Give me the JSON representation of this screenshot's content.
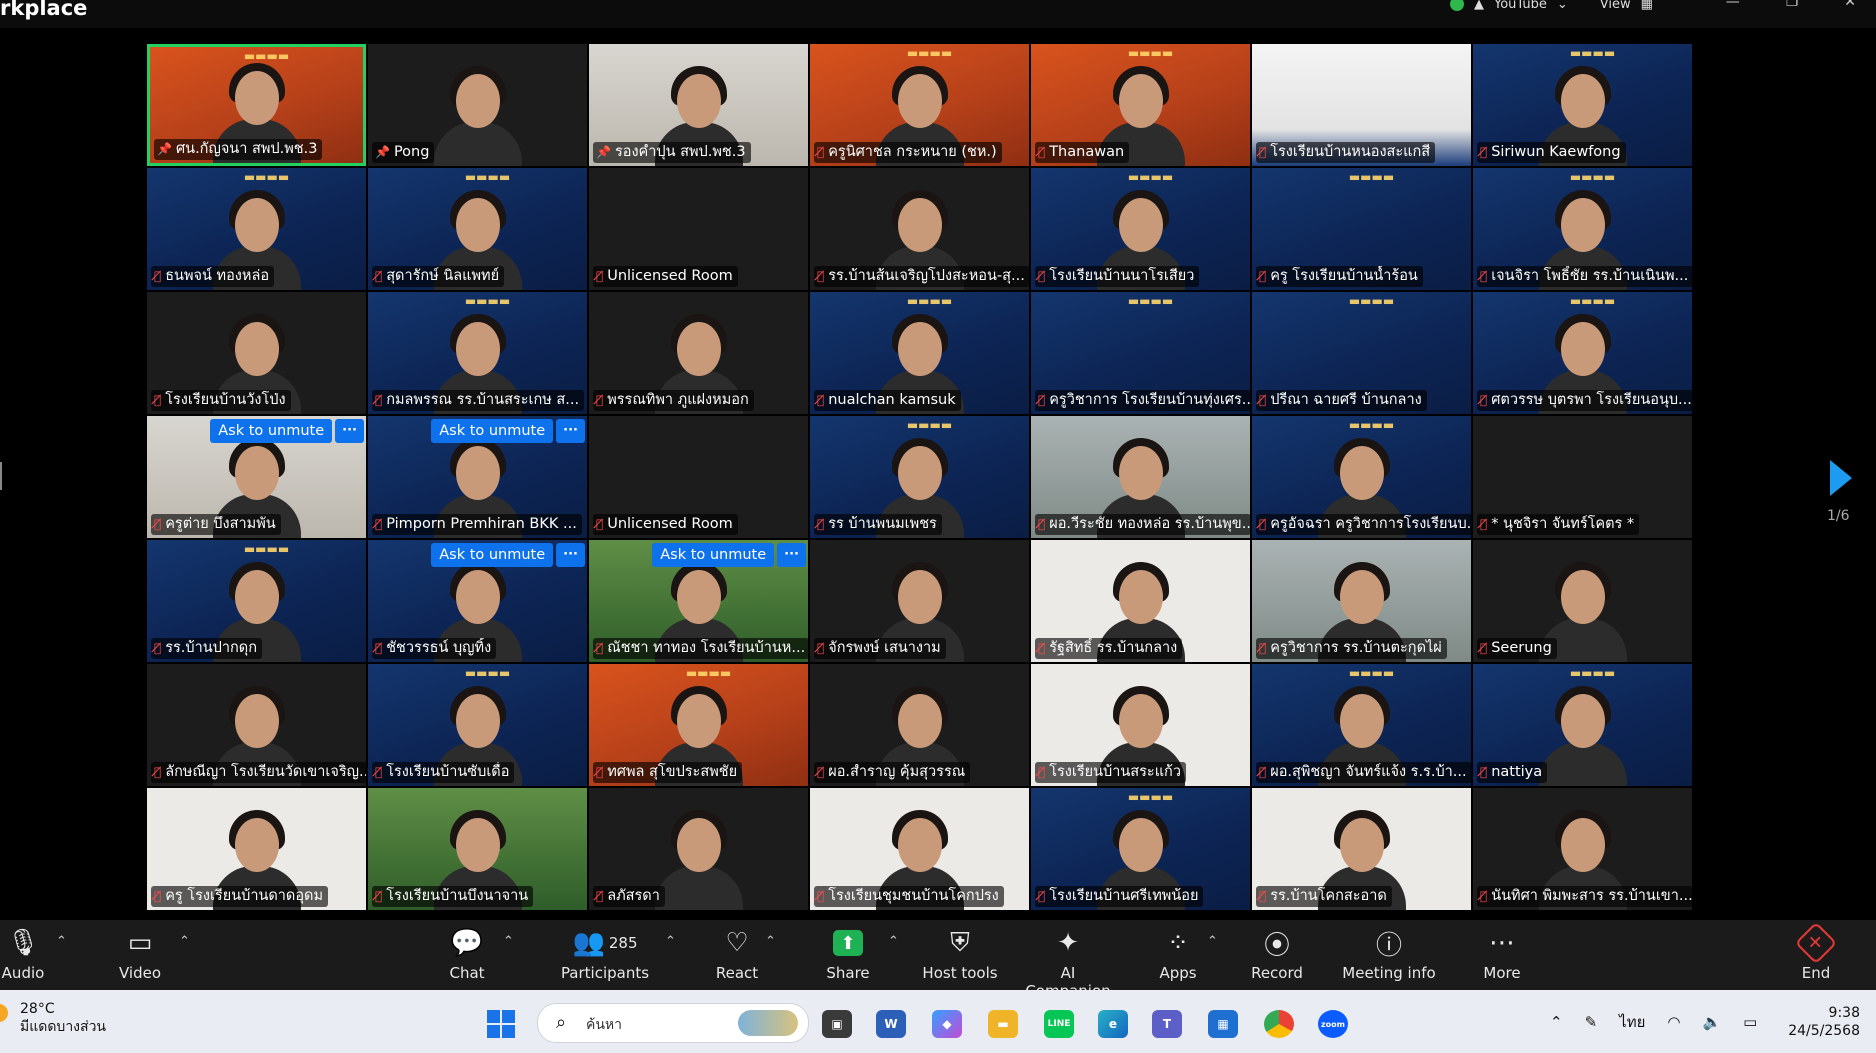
{
  "window": {
    "title": "rkplace",
    "youtube_label": "YouTube",
    "view_label": "View"
  },
  "gallery": {
    "page_indicator": "1/6",
    "unmute_label": "Ask to unmute",
    "more_label": "···",
    "tiles": [
      {
        "name": "ศน.กัญจนา สพป.พช.3",
        "icon": "pin",
        "bg": "orange",
        "active": true,
        "person": true
      },
      {
        "name": "Pong",
        "icon": "pin",
        "bg": "dark",
        "person": true
      },
      {
        "name": "รองคำปุน สพป.พช.3",
        "icon": "pin",
        "bg": "wall",
        "person": true
      },
      {
        "name": "ครูนิศาชล กระหนาย (ชห.)",
        "icon": "mic-off",
        "bg": "orange",
        "person": true
      },
      {
        "name": "Thanawan",
        "icon": "mic-off",
        "bg": "orange",
        "person": true
      },
      {
        "name": "โรงเรียนบ้านหนองสะแกสี",
        "icon": "mic-off",
        "bg": "slide",
        "person": false
      },
      {
        "name": "Siriwun Kaewfong",
        "icon": "mic-off",
        "bg": "blue",
        "person": true
      },
      {
        "name": "ธนพจน์ ทองหล่อ",
        "icon": "mic-off",
        "bg": "blue",
        "person": true
      },
      {
        "name": "สุดารักษ์ นิลแพทย์",
        "icon": "mic-off",
        "bg": "blue",
        "person": true
      },
      {
        "name": "Unlicensed Room",
        "icon": "mic-off",
        "bg": "dark",
        "person": false
      },
      {
        "name": "รร.บ้านส้นเจริญโปงสะหอน-สุ...",
        "icon": "mic-off",
        "bg": "dark",
        "person": true
      },
      {
        "name": "โรงเรียนบ้านนาโรเสียว",
        "icon": "mic-off",
        "bg": "blue",
        "person": true
      },
      {
        "name": "ครู โรงเรียนบ้านน้ำร้อน",
        "icon": "mic-off",
        "bg": "blue",
        "person": false
      },
      {
        "name": "เจนจิรา โพธิ์ชัย รร.บ้านเนินพ...",
        "icon": "mic-off",
        "bg": "blue",
        "person": true
      },
      {
        "name": "โรงเรียนบ้านวังโป่ง",
        "icon": "mic-off",
        "bg": "dark",
        "person": true
      },
      {
        "name": "กมลพรรณ รร.บ้านสระเกษ ส...",
        "icon": "mic-off",
        "bg": "blue",
        "person": true
      },
      {
        "name": "พรรณทิพา ภูแฝงหมอก",
        "icon": "mic-off",
        "bg": "dark",
        "person": true
      },
      {
        "name": "nualchan kamsuk",
        "icon": "mic-off",
        "bg": "blue",
        "person": true
      },
      {
        "name": "ครูวิชาการ โรงเรียนบ้านทุ่งเศร...",
        "icon": "mic-off",
        "bg": "blue",
        "person": false
      },
      {
        "name": "ปรีณา ฉายศรี บ้านกลาง",
        "icon": "mic-off",
        "bg": "blue",
        "person": false
      },
      {
        "name": "ศตวรรษ บุตรพา โรงเรียนอนุบ...",
        "icon": "mic-off",
        "bg": "blue",
        "person": true
      },
      {
        "name": "ครูต่าย บึงสามพัน",
        "icon": "mic-off",
        "bg": "wall",
        "person": true,
        "unmute": true
      },
      {
        "name": "Pimporn Premhiran BKK ...",
        "icon": "mic-off",
        "bg": "blue",
        "person": true,
        "unmute": true
      },
      {
        "name": "Unlicensed Room",
        "icon": "mic-off",
        "bg": "dark",
        "person": false
      },
      {
        "name": "รร บ้านพนมเพชร",
        "icon": "mic-off",
        "bg": "blue",
        "person": true
      },
      {
        "name": "ผอ.วีระชัย ทองหล่อ รร.บ้านพุข...",
        "icon": "mic-off",
        "bg": "room",
        "person": true
      },
      {
        "name": "ครูอัจฉรา ครูวิชาการโรงเรียนบ...",
        "icon": "mic-off",
        "bg": "blue",
        "person": true
      },
      {
        "name": "* นุชจิรา จันทร์โคตร *",
        "icon": "mic-off",
        "bg": "dark",
        "person": false
      },
      {
        "name": "รร.บ้านปากดุก",
        "icon": "mic-off",
        "bg": "blue",
        "person": true
      },
      {
        "name": "ชัชวรรธน์ บุญทิ้ง",
        "icon": "mic-off",
        "bg": "blue",
        "person": true,
        "unmute": true
      },
      {
        "name": "ณัชชา ทาทอง โรงเรียนบ้านห...",
        "icon": "mic-off",
        "bg": "green",
        "person": true,
        "unmute": true
      },
      {
        "name": "จักรพงษ์ เสนางาม",
        "icon": "mic-off",
        "bg": "dark",
        "person": true
      },
      {
        "name": "รัฐสิทธิ์ รร.บ้านกลาง",
        "icon": "mic-off",
        "bg": "white",
        "person": true
      },
      {
        "name": "ครูวิชาการ รร.บ้านตะกุดไผ่",
        "icon": "mic-off",
        "bg": "room",
        "person": true
      },
      {
        "name": "Seerung",
        "icon": "mic-off",
        "bg": "dark",
        "person": true
      },
      {
        "name": "ลักษณีญา โรงเรียนวัดเขาเจริญ...",
        "icon": "mic-off",
        "bg": "dark",
        "person": true
      },
      {
        "name": "โรงเรียนบ้านซับเดื่อ",
        "icon": "mic-off",
        "bg": "blue",
        "person": true
      },
      {
        "name": "ทศพล สุโขประสพชัย",
        "icon": "mic-off",
        "bg": "orange",
        "person": true
      },
      {
        "name": "ผอ.สำราญ คุ้มสุวรรณ",
        "icon": "mic-off",
        "bg": "dark",
        "person": true
      },
      {
        "name": "โรงเรียนบ้านสระแก้ว",
        "icon": "mic-off",
        "bg": "white",
        "person": true
      },
      {
        "name": "ผอ.สุพิชญา จันทร์แจ้ง ร.ร.บ้า...",
        "icon": "mic-off",
        "bg": "blue",
        "person": true
      },
      {
        "name": "nattiya",
        "icon": "mic-off",
        "bg": "blue",
        "person": true
      },
      {
        "name": "ครู โรงเรียนบ้านดาดอุดม",
        "icon": "mic-off",
        "bg": "white",
        "person": true
      },
      {
        "name": "โรงเรียนบ้านบึงนาจาน",
        "icon": "mic-off",
        "bg": "green",
        "person": true
      },
      {
        "name": "ลภัสรดา",
        "icon": "mic-off",
        "bg": "dark",
        "person": true
      },
      {
        "name": "โรงเรียนชุมชนบ้านโคกปรง",
        "icon": "mic-off",
        "bg": "white",
        "person": true
      },
      {
        "name": "โรงเรียนบ้านศรีเทพน้อย",
        "icon": "mic-off",
        "bg": "blue",
        "person": true
      },
      {
        "name": "รร.บ้านโคกสะอาด",
        "icon": "mic-off",
        "bg": "white",
        "person": true
      },
      {
        "name": "นันทิศา พิมพะสาร รร.บ้านเขา...",
        "icon": "mic-off",
        "bg": "dark",
        "person": true
      }
    ]
  },
  "toolbar": {
    "audio": "Audio",
    "video": "Video",
    "chat": "Chat",
    "participants": "Participants",
    "participants_count": "285",
    "react": "React",
    "share": "Share",
    "host_tools": "Host tools",
    "ai_companion": "AI Companion",
    "apps": "Apps",
    "record": "Record",
    "meeting_info": "Meeting info",
    "more": "More",
    "end": "End"
  },
  "taskbar": {
    "temperature": "28°C",
    "weather_text": "มีแดดบางส่วน",
    "search_placeholder": "ค้นหา",
    "language": "ไทย",
    "time": "9:38",
    "date": "24/5/2568",
    "apps": [
      "file-explorer",
      "word",
      "copilot",
      "folder",
      "line",
      "edge",
      "teams",
      "store",
      "chrome",
      "zoom"
    ]
  },
  "colors": {
    "active_speaker_border": "#23d160",
    "unmute_button": "#0e72ed",
    "mic_off": "#ff4b4b",
    "share_green": "#1fb254",
    "end_red": "#e53935",
    "nav_arrow": "#1d9bf0"
  }
}
